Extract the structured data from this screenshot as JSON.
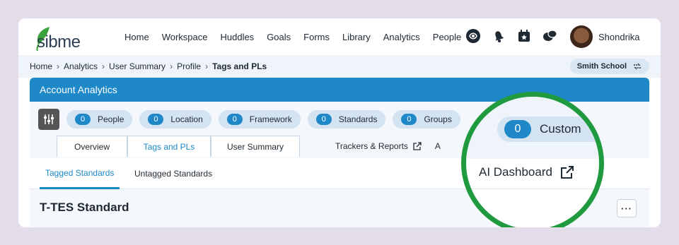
{
  "brand": {
    "logo_text": "sibme",
    "logo_color": "#3aa23a"
  },
  "nav": {
    "links": [
      "Home",
      "Workspace",
      "Huddles",
      "Goals",
      "Forms",
      "Library",
      "Analytics",
      "People"
    ],
    "icons": [
      "ai-assistant-icon",
      "notifications-bell-icon",
      "calendar-icon",
      "chat-bubbles-icon"
    ],
    "user_name": "Shondrika"
  },
  "breadcrumb": {
    "items": [
      "Home",
      "Analytics",
      "User Summary",
      "Profile",
      "Tags and PLs"
    ],
    "school": "Smith School"
  },
  "card": {
    "title": "Account Analytics",
    "filters": [
      {
        "count": "0",
        "label": "People"
      },
      {
        "count": "0",
        "label": "Location"
      },
      {
        "count": "0",
        "label": "Framework"
      },
      {
        "count": "0",
        "label": "Standards"
      },
      {
        "count": "0",
        "label": "Groups"
      }
    ],
    "tabs": [
      "Overview",
      "Tags and PLs",
      "User Summary"
    ],
    "active_tab": "Tags and PLs",
    "links": [
      "Trackers & Reports",
      "A"
    ]
  },
  "subtabs": {
    "items": [
      "Tagged Standards",
      "Untagged Standards"
    ],
    "active": "Tagged Standards"
  },
  "section": {
    "title": "T-TES Standard",
    "more_label": "···"
  },
  "magnifier": {
    "chip_count": "0",
    "chip_label": "Custom",
    "link_label": "AI Dashboard",
    "ring_color": "#1f9a3e"
  },
  "colors": {
    "accent": "#1e88c9",
    "background": "#e2dde8"
  }
}
